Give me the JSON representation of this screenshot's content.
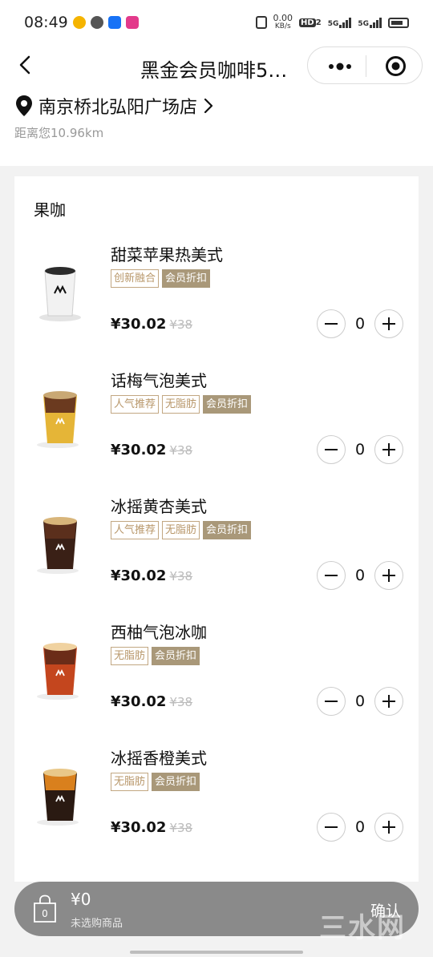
{
  "status": {
    "time": "08:49",
    "network_speed": "0.00",
    "speed_unit": "KB/s",
    "hd": "HD",
    "hd2": "2",
    "sig1": "5G",
    "sig2": "5G"
  },
  "nav": {
    "title": "黑金会员咖啡5…"
  },
  "store": {
    "name": "南京桥北弘阳广场店",
    "distance": "距离您10.96km"
  },
  "category": "果咖",
  "products": [
    {
      "name": "甜菜苹果热美式",
      "tags": [
        {
          "text": "创新融合",
          "filled": false
        },
        {
          "text": "会员折扣",
          "filled": true
        }
      ],
      "price": "¥30.02",
      "orig_price": "¥38",
      "qty": "0",
      "cup": "hot"
    },
    {
      "name": "话梅气泡美式",
      "tags": [
        {
          "text": "人气推荐",
          "filled": false
        },
        {
          "text": "无脂肪",
          "filled": false
        },
        {
          "text": "会员折扣",
          "filled": true
        }
      ],
      "price": "¥30.02",
      "orig_price": "¥38",
      "qty": "0",
      "cup": "yellow"
    },
    {
      "name": "冰摇黄杏美式",
      "tags": [
        {
          "text": "人气推荐",
          "filled": false
        },
        {
          "text": "无脂肪",
          "filled": false
        },
        {
          "text": "会员折扣",
          "filled": true
        }
      ],
      "price": "¥30.02",
      "orig_price": "¥38",
      "qty": "0",
      "cup": "dark"
    },
    {
      "name": "西柚气泡冰咖",
      "tags": [
        {
          "text": "无脂肪",
          "filled": false
        },
        {
          "text": "会员折扣",
          "filled": true
        }
      ],
      "price": "¥30.02",
      "orig_price": "¥38",
      "qty": "0",
      "cup": "red"
    },
    {
      "name": "冰摇香橙美式",
      "tags": [
        {
          "text": "无脂肪",
          "filled": false
        },
        {
          "text": "会员折扣",
          "filled": true
        }
      ],
      "price": "¥30.02",
      "orig_price": "¥38",
      "qty": "0",
      "cup": "orange"
    }
  ],
  "cart": {
    "badge": "0",
    "amount": "¥0",
    "hint": "未选购商品",
    "confirm": "确认"
  },
  "watermark": "三水网",
  "colors": {
    "tag_outline": "#c2a782",
    "tag_fill": "#a99879",
    "cart_bar": "#8a8a8a"
  }
}
